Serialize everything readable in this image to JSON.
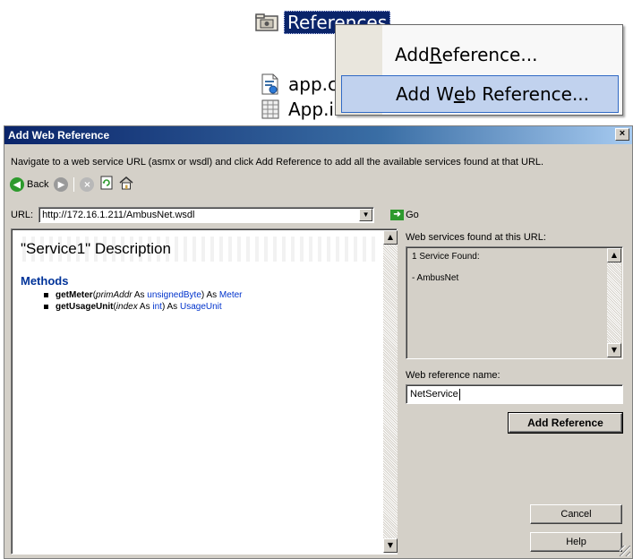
{
  "solution_explorer": {
    "references_label": "References",
    "file1_label": "app.c",
    "file2_label": "App.i"
  },
  "context_menu": {
    "items": [
      {
        "label_pre": "Add ",
        "label_accel": "R",
        "label_post": "eference..."
      },
      {
        "label_pre": "Add W",
        "label_accel": "e",
        "label_post": "b Reference..."
      }
    ],
    "selected_index": 1
  },
  "dialog": {
    "title": "Add Web Reference",
    "close_glyph": "×",
    "instruction": "Navigate to a web service URL (asmx or wsdl) and click Add Reference to add all the available services found at that URL.",
    "toolbar": {
      "back_label": "Back"
    },
    "url_label": "URL:",
    "url_value": "http://172.16.1.211/AmbusNet.wsdl",
    "go_label": "Go",
    "browser": {
      "service_title": "\"Service1\" Description",
      "methods_heading": "Methods",
      "methods": [
        {
          "name": "getMeter",
          "open": "(",
          "param": "primAddr",
          "as1": " As ",
          "param_type": "unsignedByte",
          "close": ") As ",
          "return_type": "Meter"
        },
        {
          "name": "getUsageUnit",
          "open": "(",
          "param": "index",
          "as1": " As ",
          "param_type": "int",
          "close": ") As ",
          "return_type": "UsageUnit"
        }
      ]
    },
    "found_label": "Web services found at this URL:",
    "found_count": "1 Service Found:",
    "found_service": "- AmbusNet",
    "ref_name_label": "Web reference name:",
    "ref_name_value": "NetService",
    "add_reference_button": "Add Reference",
    "cancel_button": "Cancel",
    "help_button": "Help"
  },
  "colors": {
    "titlebar": "#0a246a",
    "link": "#0033cc",
    "dialog_face": "#d4d0c8",
    "menu_highlight": "#c1d2ee"
  }
}
